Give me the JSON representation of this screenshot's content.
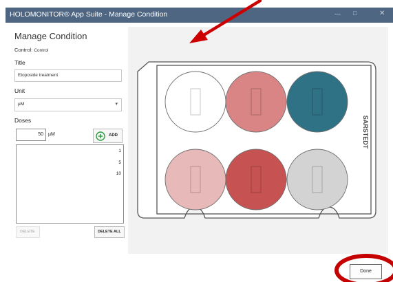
{
  "window": {
    "title": "HOLOMONITOR® App Suite - Manage Condition",
    "controls": {
      "minimize": "—",
      "maximize": "□",
      "close": "✕"
    }
  },
  "form": {
    "heading": "Manage Condition",
    "control_label": "Control:",
    "control_value": "Control",
    "title_label": "Title",
    "title_value": "Etoposide treatment",
    "unit_label": "Unit",
    "unit_value": "µM",
    "unit_chevron": "▾",
    "doses_label": "Doses",
    "dose_input_value": "50",
    "dose_unit": "µM",
    "add_label": "ADD",
    "doses": [
      "1",
      "5",
      "10"
    ],
    "delete_label": "DELETE",
    "delete_all_label": "DELETE ALL"
  },
  "plate": {
    "brand": "SARSTEDT",
    "wells": [
      {
        "row": 1,
        "col": 1,
        "color": "#ffffff"
      },
      {
        "row": 1,
        "col": 2,
        "color": "#d98585"
      },
      {
        "row": 1,
        "col": 3,
        "color": "#2f7185"
      },
      {
        "row": 2,
        "col": 1,
        "color": "#e8b9b9"
      },
      {
        "row": 2,
        "col": 2,
        "color": "#c75252"
      },
      {
        "row": 2,
        "col": 3,
        "color": "#d3d3d3"
      }
    ]
  },
  "footer": {
    "done_label": "Done"
  },
  "colors": {
    "titlebar": "#4f6682",
    "annotation": "#cc0000",
    "add_icon": "#2e9b3c"
  }
}
